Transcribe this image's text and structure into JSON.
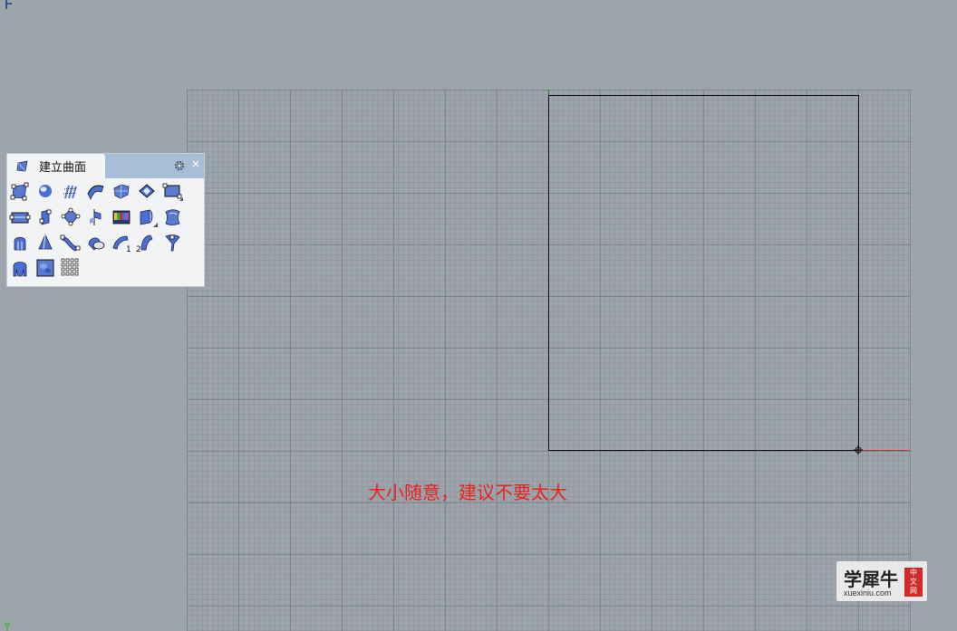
{
  "app": {
    "viewport": "top-view",
    "grid": "on"
  },
  "toolbar": {
    "title": "建立曲面",
    "close_label": "×",
    "icons": [
      "surface-from-points-icon",
      "sphere-icon",
      "network-surface-icon",
      "sweep1-icon",
      "patch-icon",
      "edge-surface-icon",
      "plane-icon",
      "rectangle-plane-icon",
      "extrude-icon",
      "loft-icon",
      "rail-revolve-icon",
      "heightfield-icon",
      "extrude-curve-icon",
      "blend-surface-icon",
      "revolve-icon",
      "cone-icon",
      "sweep-along-icon",
      "drape-icon",
      "sweep1-rail-icon",
      "sweep2-rail-icon",
      "pipe-icon",
      "patch-multi-icon",
      "heightfield-image-icon",
      "point-grid-icon"
    ],
    "sweep1_number": "1",
    "sweep2_number": "2"
  },
  "annotation": {
    "text": "大小随意，建议不要太大",
    "color": "#e8231c"
  },
  "watermark": {
    "name": "学犀牛",
    "url": "xuexiniu.com",
    "badge": [
      "中",
      "文",
      "网"
    ]
  },
  "colors": {
    "background": "#9ea4ab",
    "x_axis": "#c0392b",
    "y_axis": "#2e8b2e",
    "rectangle": "#111111",
    "panel_header": "#a8bdd6"
  }
}
